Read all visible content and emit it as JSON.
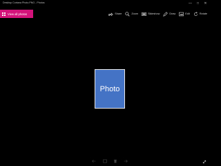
{
  "window": {
    "title": "Desktop Cortana Photo.PNG - Photos",
    "controls": [
      "—",
      "□",
      "✕"
    ]
  },
  "toolbar": {
    "view_all_label": "View all photos",
    "actions": [
      {
        "label": "Share",
        "icon": "share-icon"
      },
      {
        "label": "Zoom",
        "icon": "zoom-icon"
      },
      {
        "label": "Slideshow",
        "icon": "slideshow-icon"
      },
      {
        "label": "Draw",
        "icon": "draw-icon"
      },
      {
        "label": "Edit",
        "icon": "edit-icon"
      },
      {
        "label": "Rotate",
        "icon": "rotate-icon"
      }
    ]
  },
  "photo": {
    "label": "Photo",
    "fill": "#4472c4"
  },
  "colors": {
    "accent": "#d4137a",
    "background": "#000000"
  }
}
